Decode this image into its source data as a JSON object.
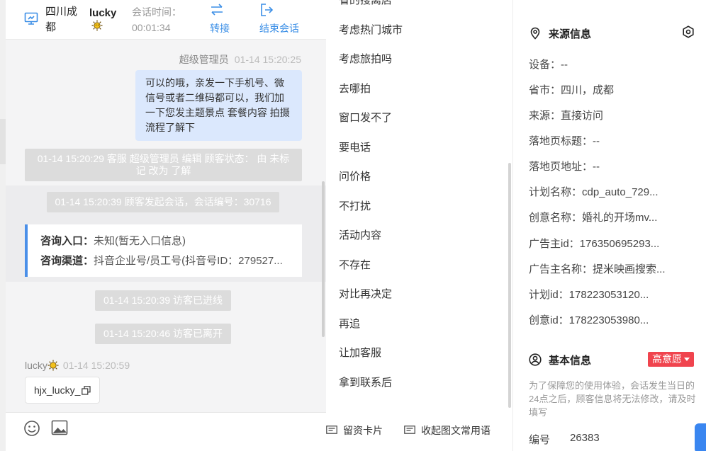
{
  "header": {
    "location": "四川成都",
    "visitor_name": "lucky",
    "session_time_label": "会话时间：",
    "session_time_value": "00:01:34",
    "transfer_label": "转接",
    "end_session_label": "结束会话"
  },
  "messages": {
    "agent_sender": "超级管理员",
    "agent_time": "01-14 15:20:25",
    "agent_text": "可以的哦，亲发一下手机号、微信号或者二维码都可以，我们加一下您发主题景点 套餐内容 拍摄流程了解下",
    "system_1": "01-14 15:20:29 客服 超级管理员 编辑 顾客状态： 由 未标记 改为 了解",
    "system_2": "01-14 15:20:39 顾客发起会话，会话编号：30716",
    "entry_label": "咨询入口：",
    "entry_value": "未知(暂无入口信息)",
    "channel_label": "咨询渠道：",
    "channel_value": "抖音企业号/员工号(抖音号ID：279527...",
    "system_3": "01-14 15:20:39 访客已进线",
    "system_4": "01-14 15:20:46 访客已离开",
    "visitor_sender": "lucky",
    "visitor_time": "01-14 15:20:59",
    "visitor_text": "hjx_lucky_"
  },
  "quick_replies": [
    "省的搜离店",
    "考虑热门城市",
    "考虑旅拍吗",
    "去哪拍",
    "窗口发不了",
    "要电话",
    "问价格",
    "不打扰",
    "活动内容",
    "不存在",
    "对比再决定",
    "再追",
    "让加客服",
    "拿到联系后"
  ],
  "quick_bottom": {
    "card_label": "留资卡片",
    "collapse_label": "收起图文常用语"
  },
  "source_info": {
    "title": "来源信息",
    "rows": [
      "设备：--",
      "省市：四川，成都",
      "来源：直接访问",
      "落地页标题：--",
      "落地页地址：--",
      "计划名称：cdp_auto_729...",
      "创意名称：婚礼的开场mv...",
      "广告主id：176350695293...",
      "广告主名称：提米映画搜索...",
      "计划id：178223053120...",
      "创意id：178223053980..."
    ]
  },
  "basic_info": {
    "title": "基本信息",
    "intent_label": "高意愿",
    "notice": "为了保障您的使用体验，会话发生当日的24点之后，顾客信息将无法修改，请及时填写",
    "id_label": "编号",
    "id_value": "26383"
  },
  "colors": {
    "accent": "#3a8ee6",
    "agent_bubble": "#dbe8fd",
    "intent_badge": "#f0444e",
    "card_border": "#4a8fe8"
  }
}
